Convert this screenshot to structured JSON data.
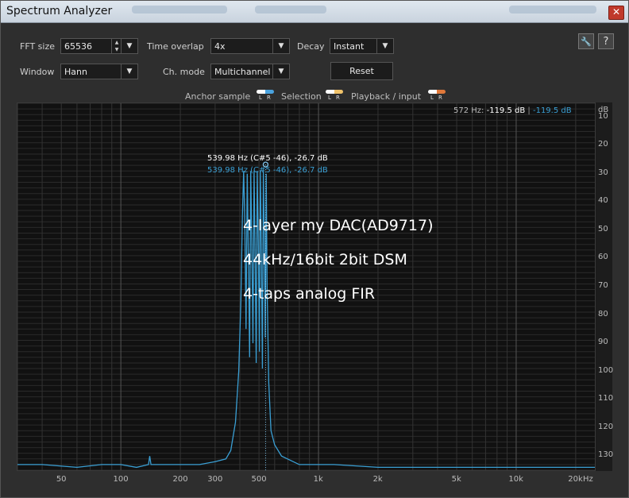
{
  "window": {
    "title": "Spectrum Analyzer",
    "close_symbol": "✕"
  },
  "controls": {
    "fft_size": {
      "label": "FFT size",
      "value": "65536"
    },
    "time_overlap": {
      "label": "Time overlap",
      "value": "4x"
    },
    "decay": {
      "label": "Decay",
      "value": "Instant"
    },
    "window": {
      "label": "Window",
      "value": "Hann"
    },
    "ch_mode": {
      "label": "Ch. mode",
      "value": "Multichannel"
    },
    "reset_label": "Reset",
    "help_symbol": "?",
    "settings_symbol": "🔧"
  },
  "legend": [
    {
      "label": "Anchor sample",
      "color": "#4aa3df"
    },
    {
      "label": "Selection",
      "color": "#f0c36a"
    },
    {
      "label": "Playback / input",
      "color": "#e0783a"
    }
  ],
  "legend_lr": {
    "l": "L",
    "r": "R"
  },
  "readout": {
    "freq": "572 Hz:",
    "left": "-119.5 dB",
    "sep": "|",
    "right": "-119.5 dB"
  },
  "peak": {
    "line1": "539.98 Hz (C#5 -46), -26.7 dB",
    "line2": "539.98 Hz (C#5 -46), -26.7 dB"
  },
  "annotations": [
    "4-layer my DAC(AD9717)",
    "44kHz/16bit 2bit DSM",
    "4-taps analog FIR"
  ],
  "colors": {
    "trace": "#3a9fd4",
    "white": "#ffffff",
    "blue": "#3a9fd4"
  },
  "chart_data": {
    "type": "line",
    "xscale": "log",
    "xlim": [
      30,
      25000
    ],
    "ylim": [
      -135,
      -5
    ],
    "xticks": [
      "50",
      "100",
      "200",
      "300",
      "500",
      "1k",
      "2k",
      "5k",
      "10k",
      "20k"
    ],
    "xtick_values": [
      50,
      100,
      200,
      300,
      500,
      1000,
      2000,
      5000,
      10000,
      20000
    ],
    "xunit": "Hz",
    "yunit": "dB",
    "yticks": [
      "10",
      "20",
      "30",
      "40",
      "50",
      "60",
      "70",
      "80",
      "90",
      "100",
      "110",
      "120",
      "130"
    ],
    "ytick_values": [
      -10,
      -20,
      -30,
      -40,
      -50,
      -60,
      -70,
      -80,
      -90,
      -100,
      -110,
      -120,
      -130
    ],
    "peak_marker": {
      "x": 539.98,
      "y": -26.7
    },
    "series": [
      {
        "points": [
          [
            30,
            -133
          ],
          [
            40,
            -133
          ],
          [
            60,
            -134
          ],
          [
            80,
            -133
          ],
          [
            100,
            -133
          ],
          [
            120,
            -134
          ],
          [
            138,
            -133
          ],
          [
            140,
            -130
          ],
          [
            142,
            -133
          ],
          [
            160,
            -133
          ],
          [
            200,
            -133
          ],
          [
            250,
            -133
          ],
          [
            300,
            -132
          ],
          [
            340,
            -131
          ],
          [
            360,
            -128
          ],
          [
            380,
            -118
          ],
          [
            395,
            -100
          ],
          [
            405,
            -75
          ],
          [
            412,
            -45
          ],
          [
            418,
            -29
          ],
          [
            424,
            -48
          ],
          [
            430,
            -85
          ],
          [
            436,
            -30
          ],
          [
            442,
            -60
          ],
          [
            448,
            -95
          ],
          [
            454,
            -29
          ],
          [
            460,
            -55
          ],
          [
            466,
            -90
          ],
          [
            472,
            -29
          ],
          [
            478,
            -60
          ],
          [
            484,
            -97
          ],
          [
            490,
            -29
          ],
          [
            496,
            -55
          ],
          [
            502,
            -93
          ],
          [
            508,
            -29
          ],
          [
            514,
            -58
          ],
          [
            520,
            -99
          ],
          [
            526,
            -29
          ],
          [
            532,
            -52
          ],
          [
            538,
            -88
          ],
          [
            544,
            -30
          ],
          [
            550,
            -72
          ],
          [
            560,
            -104
          ],
          [
            575,
            -121
          ],
          [
            600,
            -126
          ],
          [
            650,
            -130
          ],
          [
            800,
            -133
          ],
          [
            1200,
            -133
          ],
          [
            2000,
            -134
          ],
          [
            5000,
            -134
          ],
          [
            10000,
            -134
          ],
          [
            20000,
            -134
          ],
          [
            25000,
            -134
          ]
        ]
      }
    ]
  }
}
